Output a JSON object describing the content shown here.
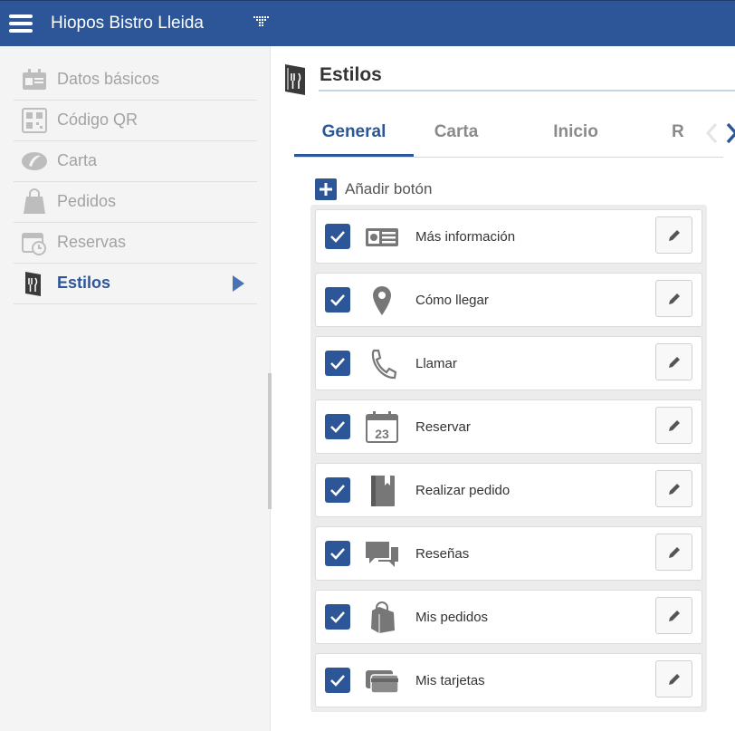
{
  "app": {
    "title": "Hiopos Bistro Lleida"
  },
  "sidebar": {
    "items": [
      {
        "label": "Datos básicos",
        "icon": "id-card-icon",
        "active": false
      },
      {
        "label": "Código QR",
        "icon": "qr-code-icon",
        "active": false
      },
      {
        "label": "Carta",
        "icon": "carta-leaf-icon",
        "active": false
      },
      {
        "label": "Pedidos",
        "icon": "shopping-bag-icon",
        "active": false
      },
      {
        "label": "Reservas",
        "icon": "calendar-clock-icon",
        "active": false
      },
      {
        "label": "Estilos",
        "icon": "menu-book-icon",
        "active": true
      }
    ]
  },
  "main": {
    "title": "Estilos",
    "tabs": [
      {
        "label": "General",
        "active": true
      },
      {
        "label": "Carta",
        "active": false
      },
      {
        "label": "Inicio",
        "active": false
      },
      {
        "label": "R",
        "active": false
      }
    ],
    "add_button_label": "Añadir botón",
    "buttons": [
      {
        "label": "Más información",
        "icon": "info-card-icon",
        "checked": true
      },
      {
        "label": "Cómo llegar",
        "icon": "map-pin-icon",
        "checked": true
      },
      {
        "label": "Llamar",
        "icon": "phone-icon",
        "checked": true
      },
      {
        "label": "Reservar",
        "icon": "calendar-icon",
        "calendar_day": "23",
        "checked": true
      },
      {
        "label": "Realizar pedido",
        "icon": "menu-book-icon",
        "checked": true
      },
      {
        "label": "Reseñas",
        "icon": "chat-bubbles-icon",
        "checked": true
      },
      {
        "label": "Mis pedidos",
        "icon": "bag-icon",
        "checked": true
      },
      {
        "label": "Mis tarjetas",
        "icon": "credit-cards-icon",
        "checked": true
      }
    ]
  },
  "colors": {
    "accent": "#2c5697",
    "header_bg": "#2c5697",
    "sidebar_bg": "#f4f4f4",
    "icon_gray": "#777777"
  }
}
